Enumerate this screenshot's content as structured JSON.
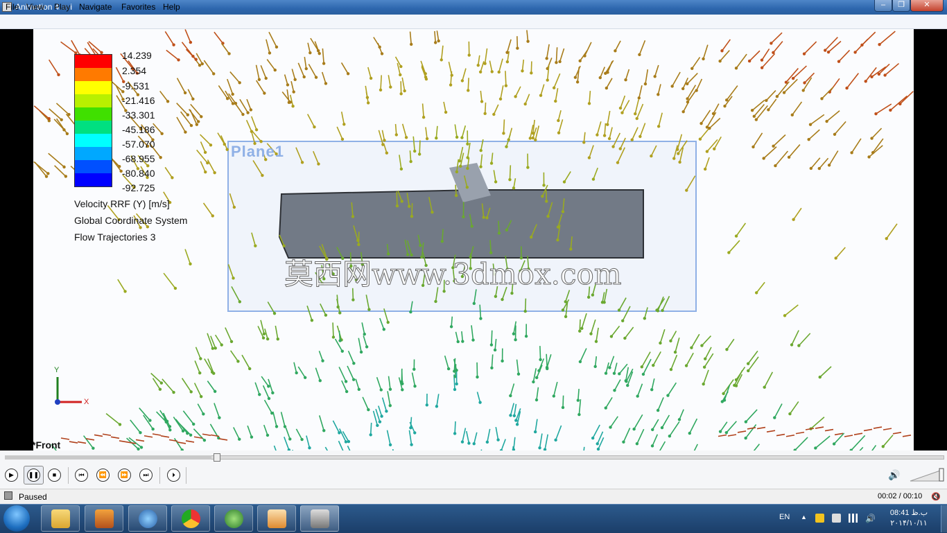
{
  "window": {
    "title": "Animation 4.avi",
    "min_glyph": "–",
    "max_glyph": "❐",
    "close_glyph": "✕"
  },
  "menu": [
    "File",
    "View",
    "Play",
    "Navigate",
    "Favorites",
    "Help"
  ],
  "scene": {
    "legend_ticks": [
      "14.239",
      "2.354",
      "-9.531",
      "-21.416",
      "-33.301",
      "-45.186",
      "-57.070",
      "-68.955",
      "-80.840",
      "-92.725"
    ],
    "legend_colors": [
      "#ff0000",
      "#ff7a00",
      "#ffff00",
      "#b8f000",
      "#40e000",
      "#00e080",
      "#00ffff",
      "#00a8ff",
      "#0050ff",
      "#0000ff"
    ],
    "legend_lines": [
      "Velocity RRF (Y) [m/s]",
      "Global Coordinate System",
      "Flow Trajectories 3"
    ],
    "plane_label": "Plane1",
    "watermark": "莫西网www.3dmox.com",
    "axis_y": "Y",
    "axis_x": "X",
    "view_label": "*Front"
  },
  "controls": {
    "play": "▶",
    "pause": "❚❚",
    "stop": "■",
    "prev": "⏮",
    "rewind": "⏪",
    "forward": "⏩",
    "next": "⏭",
    "step": "⏵",
    "seek_progress": 0.22
  },
  "status": {
    "text": "Paused",
    "time": "00:02 / 00:10",
    "mute": "🔇"
  },
  "taskbar": {
    "lang": "EN",
    "time": "08:41 ب.ظ",
    "date": "۲۰۱۴/۱۰/۱۱",
    "apps": [
      "explorer",
      "package",
      "internet",
      "chrome",
      "download",
      "media",
      "media-player-classic"
    ]
  }
}
